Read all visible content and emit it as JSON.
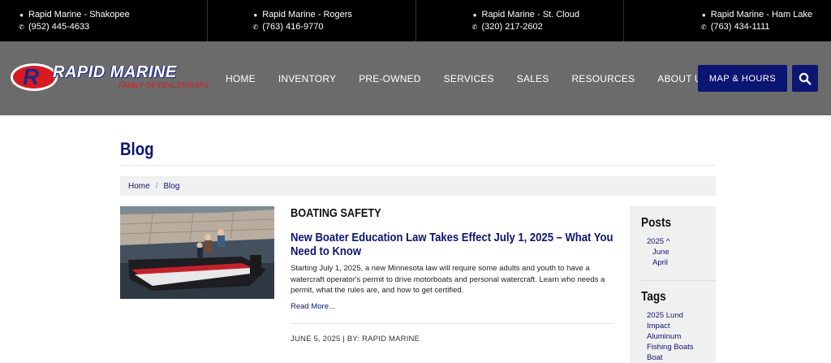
{
  "locations": [
    {
      "name": "Rapid Marine - Shakopee",
      "phone": "(952) 445-4633"
    },
    {
      "name": "Rapid Marine - Rogers",
      "phone": "(763) 416-9770"
    },
    {
      "name": "Rapid Marine - St. Cloud",
      "phone": "(320) 217-2602"
    },
    {
      "name": "Rapid Marine - Ham Lake",
      "phone": "(763) 434-1111"
    }
  ],
  "logo": {
    "brand": "RAPID MARINE",
    "tagline": "FAMILY OF DEALERSHIPS",
    "mark": "R"
  },
  "nav": {
    "items": [
      "HOME",
      "INVENTORY",
      "PRE-OWNED",
      "SERVICES",
      "SALES",
      "RESOURCES",
      "ABOUT US"
    ],
    "map_hours": "MAP & HOURS"
  },
  "page": {
    "title": "Blog"
  },
  "breadcrumb": {
    "home": "Home",
    "current": "Blog"
  },
  "post": {
    "category": "BOATING SAFETY",
    "title": "New Boater Education Law Takes Effect July 1, 2025 – What You Need to Know",
    "excerpt": "Starting July 1, 2025, a new Minnesota law will require some adults and youth to have a watercraft operator's permit to drive motorboats and personal watercraft. Learn who needs a permit, what the rules are, and how to get certified.",
    "read_more": "Read More...",
    "meta": "JUNE 5, 2025 | BY: RAPID MARINE"
  },
  "sidebar": {
    "posts_heading": "Posts",
    "year": "2025 ^",
    "months": [
      "June",
      "April"
    ],
    "tags_heading": "Tags",
    "tags": [
      "2025 Lund",
      "Impact",
      "Aluminum",
      "Fishing Boats",
      "Boat"
    ]
  },
  "colors": {
    "navy": "#0d1572",
    "header_gray": "#6b6b6b",
    "topbar": "#000000",
    "brand_red": "#d71920"
  }
}
